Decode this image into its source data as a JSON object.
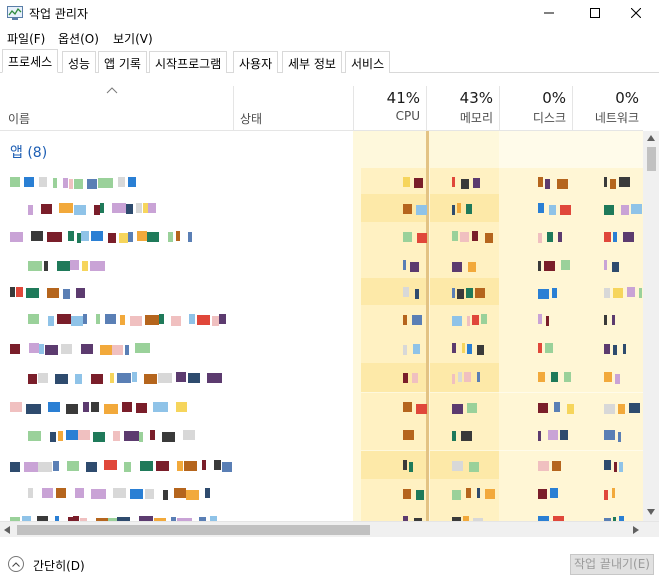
{
  "window": {
    "title": "작업 관리자"
  },
  "menu": [
    "파일(F)",
    "옵션(O)",
    "보기(V)"
  ],
  "tabs": [
    {
      "label": "프로세스",
      "active": true
    },
    {
      "label": "성능"
    },
    {
      "label": "앱 기록"
    },
    {
      "label": "시작프로그램"
    },
    {
      "label": "사용자"
    },
    {
      "label": "세부 정보"
    },
    {
      "label": "서비스"
    }
  ],
  "columns": {
    "name": "이름",
    "status": "상태",
    "cpu": {
      "pct": "41%",
      "label": "CPU"
    },
    "memory": {
      "pct": "43%",
      "label": "메모리"
    },
    "disk": {
      "pct": "0%",
      "label": "디스크"
    },
    "network": {
      "pct": "0%",
      "label": "네트워크"
    }
  },
  "group": {
    "label": "앱 (8)"
  },
  "footer": {
    "collapse_label": "간단히(D)",
    "end_task_label": "작업 끝내기(E)"
  },
  "colors": {
    "group_text": "#1e5fb4",
    "heat_light": "#fff4c4",
    "heat_medium": "#fde79c",
    "divider": "#e3c384"
  }
}
